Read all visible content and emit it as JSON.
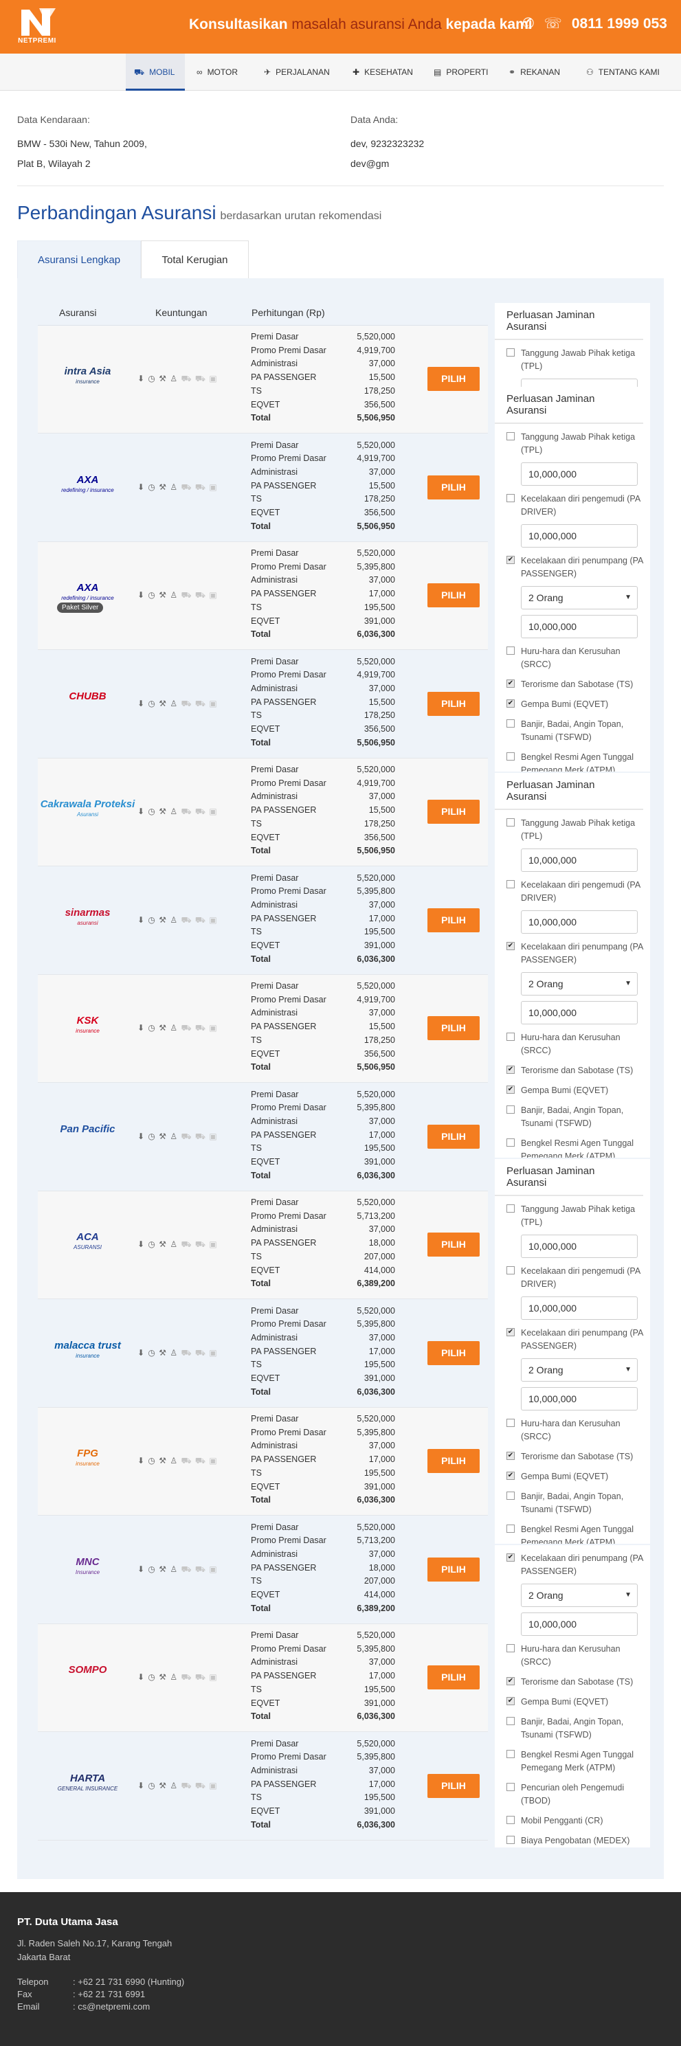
{
  "header": {
    "logo_text": "NETPREMI",
    "promo_a": "Konsultasikan ",
    "promo_b": "masalah asuransi Anda",
    "promo_c": " kepada kami",
    "phone": "0811 1999 053",
    "bg_color": "#f47d20"
  },
  "nav": {
    "items": [
      {
        "label": "MOBIL",
        "icon": "car-icon"
      },
      {
        "label": "MOTOR",
        "icon": "motorcycle-icon"
      },
      {
        "label": "PERJALANAN",
        "icon": "plane-icon"
      },
      {
        "label": "KESEHATAN",
        "icon": "medkit-icon"
      },
      {
        "label": "PROPERTI",
        "icon": "building-icon"
      },
      {
        "label": "REKANAN",
        "icon": "handshake-icon"
      },
      {
        "label": "TENTANG KAMI",
        "icon": "users-icon"
      }
    ]
  },
  "vehicle": {
    "label": "Data Kendaraan:",
    "line1": "BMW - 530i New, Tahun 2009,",
    "line2": "Plat B, Wilayah 2"
  },
  "customer": {
    "label": "Data Anda:",
    "line1": "dev, 9232323232",
    "line2": "dev@gm"
  },
  "title": {
    "main": "Perbandingan Asuransi",
    "sub": "berdasarkan urutan rekomendasi"
  },
  "tabs": [
    "Asuransi Lengkap",
    "Total Kerugian"
  ],
  "table_headers": {
    "asuransi": "Asuransi",
    "keuntungan": "Keuntungan",
    "perhitungan": "Perhitungan (Rp)"
  },
  "calc_labels": {
    "premi_dasar": "Premi Dasar",
    "promo": "Promo Premi Dasar",
    "admin": "Administrasi",
    "pa": "PA PASSENGER",
    "ts": "TS",
    "eqvet": "EQVET",
    "total": "Total"
  },
  "button_label": "PILIH",
  "insurers": [
    {
      "name": "intra Asia",
      "sub": "insurance",
      "pd": "5,520,000",
      "promo": "4,919,700",
      "admin": "37,000",
      "pa": "15,500",
      "ts": "178,250",
      "eq": "356,500",
      "total": "5,506,950"
    },
    {
      "name": "AXA",
      "sub": "redefining / insurance",
      "pd": "5,520,000",
      "promo": "4,919,700",
      "admin": "37,000",
      "pa": "15,500",
      "ts": "178,250",
      "eq": "356,500",
      "total": "5,506,950"
    },
    {
      "name": "AXA",
      "sub": "redefining / insurance",
      "badge": "Paket Silver",
      "pd": "5,520,000",
      "promo": "5,395,800",
      "admin": "37,000",
      "pa": "17,000",
      "ts": "195,500",
      "eq": "391,000",
      "total": "6,036,300"
    },
    {
      "name": "CHUBB",
      "sub": "",
      "pd": "5,520,000",
      "promo": "4,919,700",
      "admin": "37,000",
      "pa": "15,500",
      "ts": "178,250",
      "eq": "356,500",
      "total": "5,506,950"
    },
    {
      "name": "Cakrawala Proteksi",
      "sub": "Asuransi",
      "pd": "5,520,000",
      "promo": "4,919,700",
      "admin": "37,000",
      "pa": "15,500",
      "ts": "178,250",
      "eq": "356,500",
      "total": "5,506,950"
    },
    {
      "name": "sinarmas",
      "sub": "asuransi",
      "pd": "5,520,000",
      "promo": "5,395,800",
      "admin": "37,000",
      "pa": "17,000",
      "ts": "195,500",
      "eq": "391,000",
      "total": "6,036,300"
    },
    {
      "name": "KSK",
      "sub": "insurance",
      "pd": "5,520,000",
      "promo": "4,919,700",
      "admin": "37,000",
      "pa": "15,500",
      "ts": "178,250",
      "eq": "356,500",
      "total": "5,506,950"
    },
    {
      "name": "Pan Pacific",
      "sub": "",
      "pd": "5,520,000",
      "promo": "5,395,800",
      "admin": "37,000",
      "pa": "17,000",
      "ts": "195,500",
      "eq": "391,000",
      "total": "6,036,300"
    },
    {
      "name": "ACA",
      "sub": "ASURANSI",
      "pd": "5,520,000",
      "promo": "5,713,200",
      "admin": "37,000",
      "pa": "18,000",
      "ts": "207,000",
      "eq": "414,000",
      "total": "6,389,200"
    },
    {
      "name": "malacca trust",
      "sub": "insurance",
      "pd": "5,520,000",
      "promo": "5,395,800",
      "admin": "37,000",
      "pa": "17,000",
      "ts": "195,500",
      "eq": "391,000",
      "total": "6,036,300"
    },
    {
      "name": "FPG",
      "sub": "insurance",
      "pd": "5,520,000",
      "promo": "5,395,800",
      "admin": "37,000",
      "pa": "17,000",
      "ts": "195,500",
      "eq": "391,000",
      "total": "6,036,300"
    },
    {
      "name": "MNC",
      "sub": "Insurance",
      "pd": "5,520,000",
      "promo": "5,713,200",
      "admin": "37,000",
      "pa": "18,000",
      "ts": "207,000",
      "eq": "414,000",
      "total": "6,389,200"
    },
    {
      "name": "SOMPO",
      "sub": "",
      "pd": "5,520,000",
      "promo": "5,395,800",
      "admin": "37,000",
      "pa": "17,000",
      "ts": "195,500",
      "eq": "391,000",
      "total": "6,036,300"
    },
    {
      "name": "HARTA",
      "sub": "GENERAL INSURANCE",
      "pd": "5,520,000",
      "promo": "5,395,800",
      "admin": "37,000",
      "pa": "17,000",
      "ts": "195,500",
      "eq": "391,000",
      "total": "6,036,300"
    }
  ],
  "sidebar": {
    "title": "Perluasan Jaminan Asuransi",
    "tpl": "Tanggung Jawab Pihak ketiga (TPL)",
    "tpl_value": "10,000,000",
    "pa_driver": "Kecelakaan diri pengemudi (PA DRIVER)",
    "pa_driver_value": "10,000,000",
    "pa_passenger": "Kecelakaan diri penumpang (PA PASSENGER)",
    "pa_passenger_count": "2 Orang",
    "pa_passenger_value": "10,000,000",
    "srcc": "Huru-hara dan Kerusuhan (SRCC)",
    "ts": "Terorisme dan Sabotase (TS)",
    "eqvet": "Gempa Bumi (EQVET)",
    "tsfwd": "Banjir, Badai, Angin Topan, Tsunami (TSFWD)",
    "atpm": "Bengkel Resmi Agen Tunggal Pemegang Merk (ATPM)",
    "tbod": "Pencurian oleh Pengemudi (TBOD)",
    "cr": "Mobil Pengganti (CR)",
    "medex": "Biaya Pengobatan (MEDEX)"
  },
  "footer": {
    "company": "PT. Duta Utama Jasa",
    "address1": "Jl. Raden Saleh No.17, Karang Tengah",
    "address2": "Jakarta Barat",
    "phone_label": "Telepon",
    "phone": ": +62 21 731 6990 (Hunting)",
    "fax_label": "Fax",
    "fax": ": +62 21 731 6991",
    "email_label": "Email",
    "email": ": cs@netpremi.com"
  }
}
